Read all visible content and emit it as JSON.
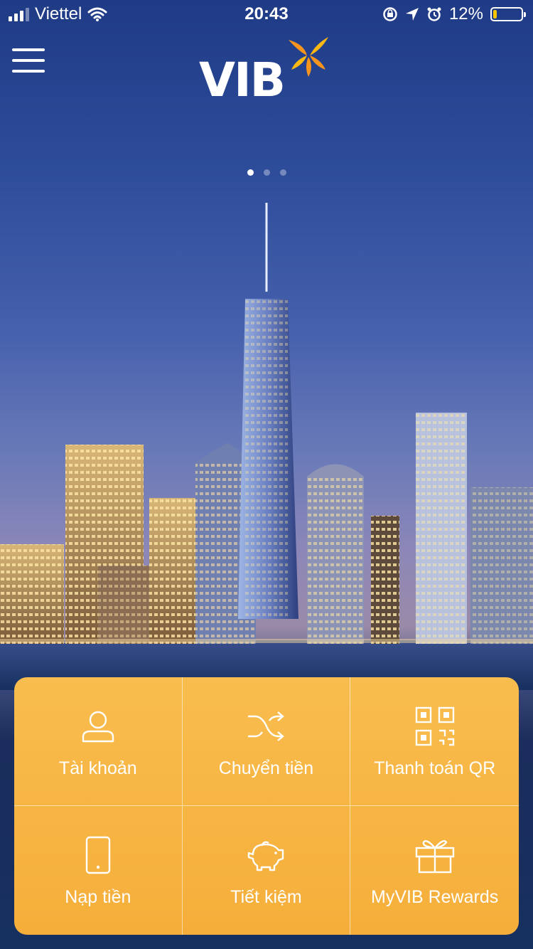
{
  "status_bar": {
    "carrier": "Viettel",
    "time": "20:43",
    "battery_percent": "12%",
    "battery_level": 0.12,
    "battery_color": "#f7c600"
  },
  "header": {
    "menu_icon": "hamburger-menu-icon",
    "logo_text": "VIB",
    "logo_accent_color": "#f7941d"
  },
  "carousel": {
    "page_count": 3,
    "active_index": 0
  },
  "quick_actions": [
    {
      "label": "Tài khoản",
      "icon": "user-icon"
    },
    {
      "label": "Chuyển tiền",
      "icon": "shuffle-transfer-icon"
    },
    {
      "label": "Thanh toán QR",
      "icon": "qr-code-icon"
    },
    {
      "label": "Nạp tiền",
      "icon": "phone-topup-icon"
    },
    {
      "label": "Tiết kiệm",
      "icon": "piggy-bank-icon"
    },
    {
      "label": "MyVIB Rewards",
      "icon": "gift-icon"
    }
  ],
  "colors": {
    "tile_background": "#f6b344",
    "tile_text": "#ffffff"
  }
}
